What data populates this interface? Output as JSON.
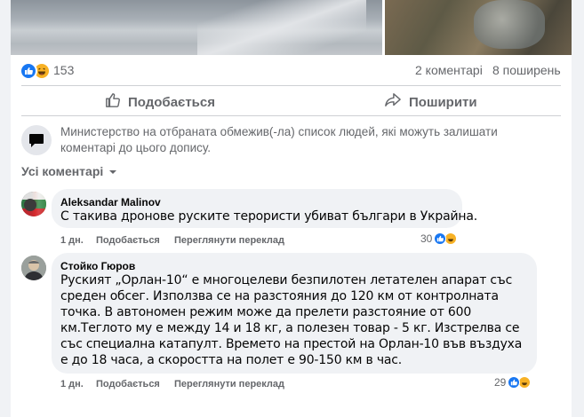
{
  "post": {
    "reaction_count": "153",
    "comments_count": "2 коментарі",
    "shares_count": "8 поширень",
    "like_label": "Подобається",
    "share_label": "Поширити",
    "restriction_notice": "Министерство на отбраната обмежив(-ла) список людей, які можуть залишати коментарі до цього допису.",
    "comments_filter": "Усі коментарі"
  },
  "comments": [
    {
      "author": "Aleksandar Malinov",
      "text": "С такива дронове руските терористи убиват българи в Украйна.",
      "time": "1 дн.",
      "like": "Подобається",
      "translate": "Переглянути переклад",
      "reactions": "30"
    },
    {
      "author": "Стойко Гюров",
      "text": "Руският „Орлан-10“ е многоцелеви безпилотен летателен апарат със среден обсег. Използва се на разстояния до 120 км от контролната точка. В автономен режим може да прелети разстояние от 600 км.Теглото му е между 14 и 18 кг, а полезен товар - 5 кг. Изстрелва се със специална катапулт. Времето на престой на Орлан-10 във въздуха е до 18 часа, а скоростта на полет е 90-150 км в час.",
      "time": "1 дн.",
      "like": "Подобається",
      "translate": "Переглянути переклад",
      "reactions": "29"
    }
  ],
  "colors": {
    "accent": "#1877f2",
    "haha": "#f7b125",
    "muted": "#65676b",
    "bubble": "#f0f2f5"
  },
  "icons": [
    "like-icon",
    "haha-icon",
    "thumbs-up-icon",
    "share-icon",
    "chat-bubble-icon",
    "chevron-down-icon"
  ]
}
